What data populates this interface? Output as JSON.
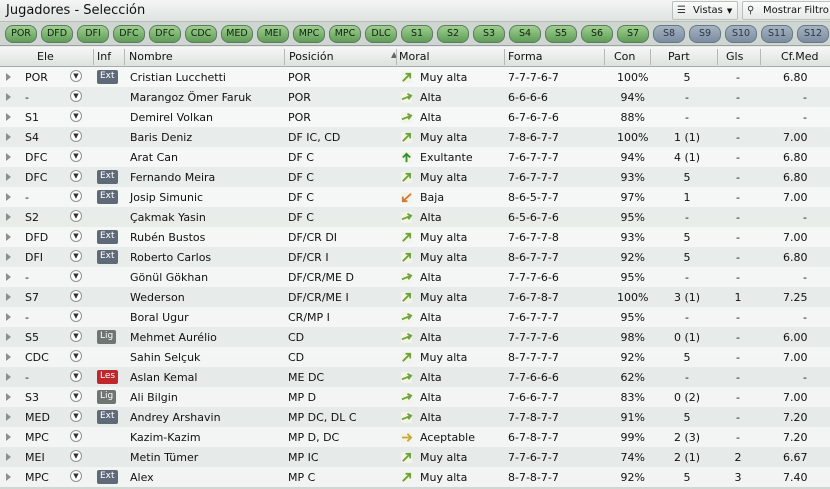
{
  "window": {
    "title": "Jugadores - Selección",
    "views_label": "Vistas",
    "filter_label": "Mostrar Filtro"
  },
  "tabs": [
    {
      "label": "POR",
      "dim": false
    },
    {
      "label": "DFD",
      "dim": false
    },
    {
      "label": "DFI",
      "dim": false
    },
    {
      "label": "DFC",
      "dim": false
    },
    {
      "label": "DFC",
      "dim": false
    },
    {
      "label": "CDC",
      "dim": false
    },
    {
      "label": "MED",
      "dim": false
    },
    {
      "label": "MEI",
      "dim": false
    },
    {
      "label": "MPC",
      "dim": false
    },
    {
      "label": "MPC",
      "dim": false
    },
    {
      "label": "DLC",
      "dim": false
    },
    {
      "label": "S1",
      "dim": false
    },
    {
      "label": "S2",
      "dim": false
    },
    {
      "label": "S3",
      "dim": false
    },
    {
      "label": "S4",
      "dim": false
    },
    {
      "label": "S5",
      "dim": false
    },
    {
      "label": "S6",
      "dim": false
    },
    {
      "label": "S7",
      "dim": false
    },
    {
      "label": "S8",
      "dim": true
    },
    {
      "label": "S9",
      "dim": true
    },
    {
      "label": "S10",
      "dim": true
    },
    {
      "label": "S11",
      "dim": true
    },
    {
      "label": "S12",
      "dim": true
    }
  ],
  "columns": {
    "ele": "Ele",
    "inf": "Inf",
    "nombre": "Nombre",
    "posicion": "Posición",
    "moral": "Moral",
    "forma": "Forma",
    "con": "Con",
    "part": "Part",
    "gls": "Gls",
    "cfmed": "Cf.Med"
  },
  "colors": {
    "tab_active": "#5f9c58",
    "tab_dim": "#7c8da0",
    "badge_ext": "#5f6a78",
    "badge_lig": "#6e7572",
    "badge_les": "#c0272d"
  },
  "rows": [
    {
      "ele": "POR",
      "inf": "Ext",
      "nombre": "Cristian Lucchetti",
      "posicion": "POR",
      "moral": "Muy alta",
      "moral_icon": "arrow-up-right-icon",
      "forma": "7-7-7-6-7",
      "con": "100%",
      "part": "5",
      "gls": "-",
      "cfmed": "6.80"
    },
    {
      "ele": "-",
      "inf": "",
      "nombre": "Marangoz Ömer Faruk",
      "posicion": "POR",
      "moral": "Alta",
      "moral_icon": "arrow-right-up-icon",
      "forma": "6-6-6-6",
      "con": "94%",
      "part": "-",
      "gls": "-",
      "cfmed": "-"
    },
    {
      "ele": "S1",
      "inf": "",
      "nombre": "Demirel Volkan",
      "posicion": "POR",
      "moral": "Alta",
      "moral_icon": "arrow-right-up-icon",
      "forma": "6-7-6-7-6",
      "con": "88%",
      "part": "-",
      "gls": "-",
      "cfmed": "-"
    },
    {
      "ele": "S4",
      "inf": "",
      "nombre": "Baris Deniz",
      "posicion": "DF IC, CD",
      "moral": "Muy alta",
      "moral_icon": "arrow-up-right-icon",
      "forma": "7-8-6-7-7",
      "con": "100%",
      "part": "1 (1)",
      "gls": "-",
      "cfmed": "7.00"
    },
    {
      "ele": "DFC",
      "inf": "",
      "nombre": "Arat Can",
      "posicion": "DF C",
      "moral": "Exultante",
      "moral_icon": "arrow-up-icon",
      "forma": "7-6-7-7-7",
      "con": "94%",
      "part": "4 (1)",
      "gls": "-",
      "cfmed": "6.80"
    },
    {
      "ele": "DFC",
      "inf": "Ext",
      "nombre": "Fernando Meira",
      "posicion": "DF C",
      "moral": "Muy alta",
      "moral_icon": "arrow-up-right-icon",
      "forma": "7-6-7-7-7",
      "con": "93%",
      "part": "5",
      "gls": "-",
      "cfmed": "6.80"
    },
    {
      "ele": "-",
      "inf": "Ext",
      "nombre": "Josip Simunic",
      "posicion": "DF C",
      "moral": "Baja",
      "moral_icon": "arrow-down-left-icon",
      "forma": "8-6-5-7-7",
      "con": "97%",
      "part": "1",
      "gls": "-",
      "cfmed": "7.00"
    },
    {
      "ele": "S2",
      "inf": "",
      "nombre": "Çakmak Yasin",
      "posicion": "DF C",
      "moral": "Alta",
      "moral_icon": "arrow-right-up-icon",
      "forma": "6-5-6-7-6",
      "con": "95%",
      "part": "-",
      "gls": "-",
      "cfmed": "-"
    },
    {
      "ele": "DFD",
      "inf": "Ext",
      "nombre": "Rubén Bustos",
      "posicion": "DF/CR DI",
      "moral": "Muy alta",
      "moral_icon": "arrow-up-right-icon",
      "forma": "7-6-7-7-8",
      "con": "93%",
      "part": "5",
      "gls": "-",
      "cfmed": "7.00"
    },
    {
      "ele": "DFI",
      "inf": "Ext",
      "nombre": "Roberto Carlos",
      "posicion": "DF/CR I",
      "moral": "Muy alta",
      "moral_icon": "arrow-up-right-icon",
      "forma": "8-6-7-7-7",
      "con": "92%",
      "part": "5",
      "gls": "-",
      "cfmed": "6.80"
    },
    {
      "ele": "-",
      "inf": "",
      "nombre": "Gönül Gökhan",
      "posicion": "DF/CR/ME D",
      "moral": "Alta",
      "moral_icon": "arrow-right-up-icon",
      "forma": "7-7-7-6-6",
      "con": "95%",
      "part": "-",
      "gls": "-",
      "cfmed": "-"
    },
    {
      "ele": "S7",
      "inf": "",
      "nombre": "Wederson",
      "posicion": "DF/CR/ME I",
      "moral": "Muy alta",
      "moral_icon": "arrow-up-right-icon",
      "forma": "7-6-7-8-7",
      "con": "100%",
      "part": "3 (1)",
      "gls": "1",
      "cfmed": "7.25"
    },
    {
      "ele": "-",
      "inf": "",
      "nombre": "Boral Ugur",
      "posicion": "CR/MP I",
      "moral": "Alta",
      "moral_icon": "arrow-right-up-icon",
      "forma": "7-6-7-7-7",
      "con": "95%",
      "part": "-",
      "gls": "-",
      "cfmed": "-"
    },
    {
      "ele": "S5",
      "inf": "Lig",
      "nombre": "Mehmet Aurélio",
      "posicion": "CD",
      "moral": "Alta",
      "moral_icon": "arrow-right-up-icon",
      "forma": "7-7-7-7-6",
      "con": "98%",
      "part": "0 (1)",
      "gls": "-",
      "cfmed": "6.00"
    },
    {
      "ele": "CDC",
      "inf": "",
      "nombre": "Sahin Selçuk",
      "posicion": "CD",
      "moral": "Muy alta",
      "moral_icon": "arrow-up-right-icon",
      "forma": "8-7-7-7-7",
      "con": "92%",
      "part": "5",
      "gls": "-",
      "cfmed": "7.00"
    },
    {
      "ele": "-",
      "inf": "Les",
      "nombre": "Aslan Kemal",
      "posicion": "ME DC",
      "moral": "Alta",
      "moral_icon": "arrow-right-up-icon",
      "forma": "7-7-6-6-6",
      "con": "62%",
      "part": "-",
      "gls": "-",
      "cfmed": "-"
    },
    {
      "ele": "S3",
      "inf": "Lig",
      "nombre": "Ali Bilgin",
      "posicion": "MP D",
      "moral": "Alta",
      "moral_icon": "arrow-right-up-icon",
      "forma": "7-6-6-7-7",
      "con": "83%",
      "part": "0 (2)",
      "gls": "-",
      "cfmed": "7.00"
    },
    {
      "ele": "MED",
      "inf": "Ext",
      "nombre": "Andrey Arshavin",
      "posicion": "MP DC, DL C",
      "moral": "Alta",
      "moral_icon": "arrow-right-up-icon",
      "forma": "7-7-8-7-7",
      "con": "91%",
      "part": "5",
      "gls": "-",
      "cfmed": "7.20"
    },
    {
      "ele": "MPC",
      "inf": "",
      "nombre": "Kazim-Kazim",
      "posicion": "MP D, DC",
      "moral": "Aceptable",
      "moral_icon": "arrow-right-icon",
      "forma": "6-7-8-7-7",
      "con": "99%",
      "part": "2 (3)",
      "gls": "-",
      "cfmed": "7.20"
    },
    {
      "ele": "MEI",
      "inf": "",
      "nombre": "Metin Tümer",
      "posicion": "MP IC",
      "moral": "Muy alta",
      "moral_icon": "arrow-up-right-icon",
      "forma": "7-7-6-7-7",
      "con": "74%",
      "part": "2 (1)",
      "gls": "2",
      "cfmed": "6.67"
    },
    {
      "ele": "MPC",
      "inf": "Ext",
      "nombre": "Alex",
      "posicion": "MP C",
      "moral": "Muy alta",
      "moral_icon": "arrow-up-right-icon",
      "forma": "8-7-8-7-7",
      "con": "92%",
      "part": "5",
      "gls": "3",
      "cfmed": "7.40"
    }
  ]
}
